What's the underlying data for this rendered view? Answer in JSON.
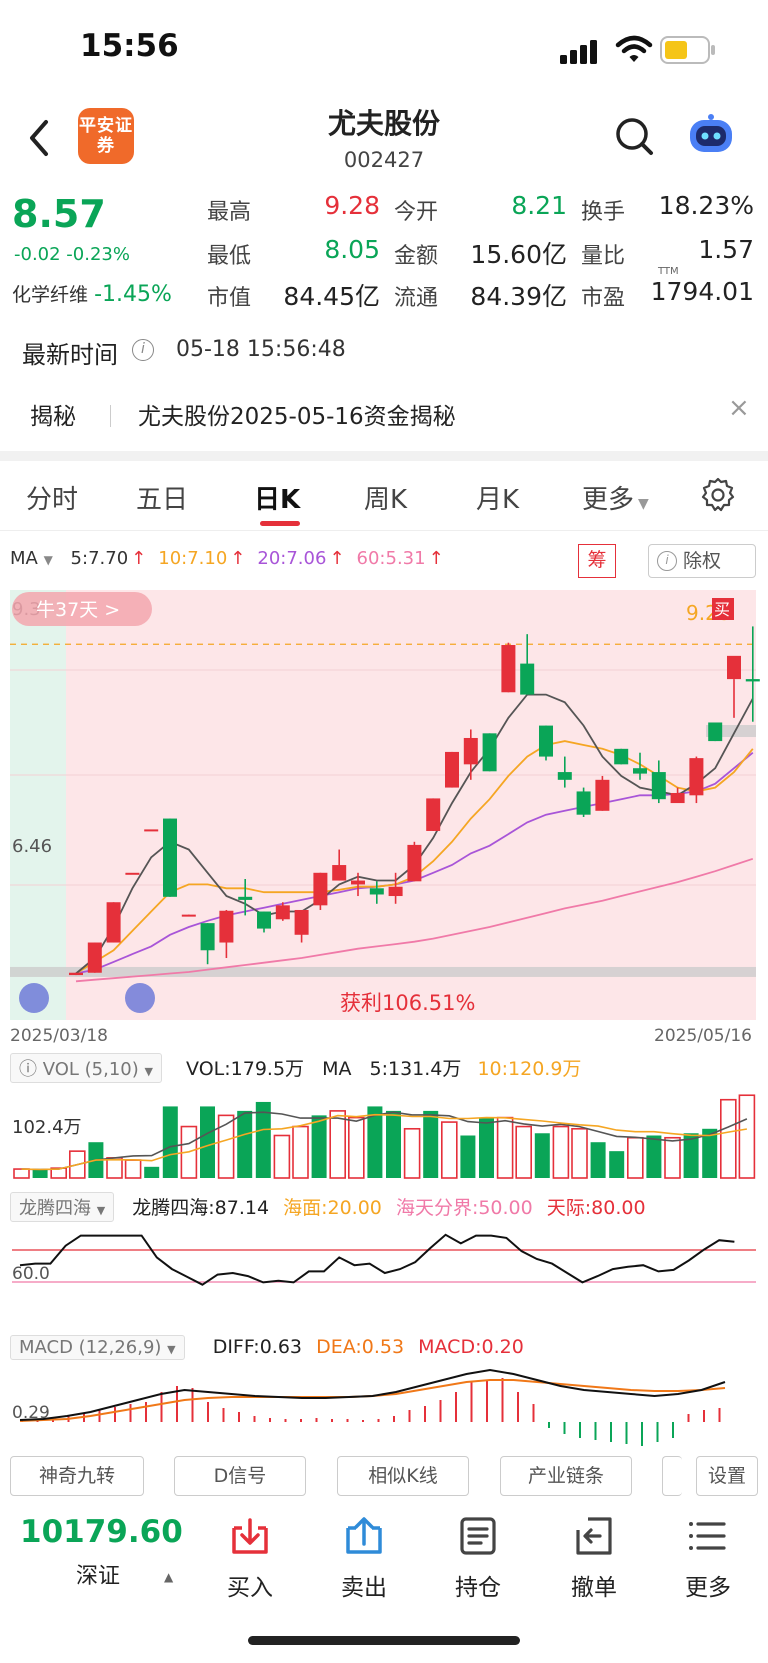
{
  "status": {
    "time": "15:56"
  },
  "header": {
    "logo_text": "平安证券",
    "stock_name": "尤夫股份",
    "stock_code": "002427"
  },
  "quote": {
    "price": "8.57",
    "change": "-0.02 -0.23%",
    "industry_label": "化学纤维",
    "industry_change": "-1.45%",
    "rows": [
      [
        {
          "k": "最高",
          "v": "9.28",
          "c": "red"
        },
        {
          "k": "今开",
          "v": "8.21",
          "c": "green"
        },
        {
          "k": "换手",
          "v": "18.23%",
          "c": "dark"
        }
      ],
      [
        {
          "k": "最低",
          "v": "8.05",
          "c": "green"
        },
        {
          "k": "金额",
          "v": "15.60亿",
          "c": "dark"
        },
        {
          "k": "量比",
          "v": "1.57",
          "c": "dark"
        }
      ],
      [
        {
          "k": "市值",
          "v": "84.45亿",
          "c": "dark"
        },
        {
          "k": "流通",
          "v": "84.39亿",
          "c": "dark"
        },
        {
          "k": "市盈",
          "v": "1794.01",
          "c": "dark"
        }
      ]
    ],
    "ttm": "TTM"
  },
  "latest_time": {
    "label": "最新时间",
    "value": "05-18 15:56:48"
  },
  "reveal": {
    "label": "揭秘",
    "text": "尤夫股份2025-05-16资金揭秘",
    "close": "×"
  },
  "tabs": [
    "分时",
    "五日",
    "日K",
    "周K",
    "月K",
    "更多"
  ],
  "active_tab": "日K",
  "ma": {
    "name": "MA",
    "items": [
      {
        "t": "5:7.70",
        "color": "#333333"
      },
      {
        "t": "10:7.10",
        "color": "#f5a623"
      },
      {
        "t": "20:7.06",
        "color": "#a855d8"
      },
      {
        "t": "60:5.31",
        "color": "#f07aa8"
      }
    ]
  },
  "chou": "筹",
  "fuquan": "除权",
  "chart_data": {
    "type": "candlestick",
    "date_start": "2025/03/18",
    "date_end": "2025/05/16",
    "price_labels": [
      "9.3",
      "6.46"
    ],
    "high_marker": "9.28",
    "buy_marker": "买",
    "streak": "牛37天",
    "profit": "获利106.51%",
    "ohlc": [
      [
        4.78,
        4.81,
        4.78,
        4.81
      ],
      [
        4.81,
        5.2,
        4.81,
        5.2
      ],
      [
        5.2,
        5.72,
        5.2,
        5.72
      ],
      [
        6.1,
        6.1,
        6.1,
        6.1
      ],
      [
        6.66,
        6.66,
        6.66,
        6.66
      ],
      [
        6.8,
        6.8,
        5.79,
        5.79
      ],
      [
        5.55,
        5.56,
        5.55,
        5.56
      ],
      [
        5.45,
        5.45,
        4.92,
        5.1
      ],
      [
        5.2,
        5.62,
        5.0,
        5.61
      ],
      [
        5.79,
        6.02,
        5.55,
        5.75
      ],
      [
        5.6,
        5.6,
        5.33,
        5.38
      ],
      [
        5.5,
        5.72,
        5.48,
        5.68
      ],
      [
        5.3,
        5.62,
        5.2,
        5.62
      ],
      [
        5.68,
        6.1,
        5.62,
        6.1
      ],
      [
        6.0,
        6.4,
        6.0,
        6.2
      ],
      [
        5.95,
        6.1,
        5.8,
        6.0
      ],
      [
        5.9,
        5.99,
        5.7,
        5.82
      ],
      [
        5.8,
        6.1,
        5.7,
        5.92
      ],
      [
        5.99,
        6.5,
        5.99,
        6.46
      ],
      [
        6.64,
        7.06,
        6.64,
        7.06
      ],
      [
        7.2,
        7.66,
        7.2,
        7.66
      ],
      [
        7.5,
        7.95,
        7.3,
        7.84
      ],
      [
        7.9,
        7.9,
        7.41,
        7.41
      ],
      [
        8.43,
        9.07,
        8.43,
        9.04
      ],
      [
        8.8,
        9.18,
        8.4,
        8.4
      ],
      [
        8.0,
        8.0,
        7.55,
        7.6
      ],
      [
        7.4,
        7.6,
        7.2,
        7.3
      ],
      [
        7.15,
        7.2,
        6.82,
        6.85
      ],
      [
        6.9,
        7.35,
        6.9,
        7.3
      ],
      [
        7.7,
        7.7,
        7.5,
        7.5
      ],
      [
        7.45,
        7.65,
        7.3,
        7.38
      ],
      [
        7.4,
        7.55,
        7.0,
        7.05
      ],
      [
        7.0,
        7.2,
        7.05,
        7.13
      ],
      [
        7.1,
        7.6,
        7.0,
        7.58
      ],
      [
        8.04,
        8.04,
        7.8,
        7.8
      ],
      [
        8.6,
        8.6,
        8.1,
        8.9
      ],
      [
        8.6,
        9.28,
        8.05,
        8.57
      ]
    ],
    "ma5": [
      4.8,
      5.0,
      5.4,
      5.9,
      6.3,
      6.5,
      6.4,
      6.1,
      5.8,
      5.7,
      5.55,
      5.6,
      5.6,
      5.75,
      5.95,
      6.05,
      6.0,
      6.0,
      6.2,
      6.55,
      7.0,
      7.4,
      7.7,
      8.1,
      8.4,
      8.4,
      8.3,
      8.0,
      7.6,
      7.35,
      7.2,
      7.15,
      7.1,
      7.25,
      7.45,
      7.9,
      8.35
    ],
    "ma10": [
      4.8,
      4.95,
      5.1,
      5.35,
      5.6,
      5.85,
      5.95,
      5.95,
      5.9,
      5.9,
      5.85,
      5.85,
      5.85,
      5.85,
      5.88,
      5.92,
      5.92,
      5.95,
      6.05,
      6.25,
      6.5,
      6.8,
      7.05,
      7.35,
      7.6,
      7.75,
      7.8,
      7.75,
      7.7,
      7.62,
      7.5,
      7.35,
      7.2,
      7.15,
      7.2,
      7.4,
      7.7
    ],
    "ma20": [
      4.8,
      4.85,
      4.95,
      5.05,
      5.15,
      5.3,
      5.4,
      5.48,
      5.55,
      5.6,
      5.65,
      5.7,
      5.75,
      5.8,
      5.85,
      5.9,
      5.92,
      5.95,
      6.0,
      6.1,
      6.2,
      6.35,
      6.45,
      6.6,
      6.75,
      6.85,
      6.9,
      6.95,
      7.0,
      7.05,
      7.1,
      7.1,
      7.12,
      7.15,
      7.25,
      7.45,
      7.65
    ],
    "ma60": [
      4.7,
      4.72,
      4.74,
      4.76,
      4.78,
      4.8,
      4.82,
      4.85,
      4.88,
      4.91,
      4.94,
      4.97,
      5.0,
      5.04,
      5.08,
      5.12,
      5.15,
      5.18,
      5.21,
      5.25,
      5.3,
      5.35,
      5.4,
      5.46,
      5.52,
      5.58,
      5.64,
      5.69,
      5.74,
      5.8,
      5.86,
      5.92,
      5.98,
      6.05,
      6.12,
      6.2,
      6.28
    ]
  },
  "vol": {
    "selector": "VOL (5,10)",
    "vol": "VOL:179.5万",
    "ma": "MA",
    "ma5": "5:131.4万",
    "ma10": "10:120.9万",
    "axis": "102.4万",
    "values": [
      20,
      18,
      22,
      60,
      80,
      45,
      40,
      25,
      160,
      115,
      160,
      140,
      150,
      170,
      95,
      115,
      140,
      150,
      135,
      160,
      150,
      110,
      150,
      125,
      95,
      135,
      135,
      115,
      100,
      115,
      110,
      80,
      60,
      90,
      95,
      90,
      100,
      110,
      175,
      185
    ]
  },
  "dragon": {
    "selector": "龙腾四海",
    "value": "龙腾四海:87.14",
    "hai": "海面:20.00",
    "haitian": "海天分界:50.00",
    "tianji": "天际:80.00",
    "axis": "60.0"
  },
  "macd": {
    "selector": "MACD (12,26,9)",
    "diff": "DIFF:0.63",
    "dea": "DEA:0.53",
    "macd": "MACD:0.20",
    "axis": "0.29"
  },
  "chips": [
    "神奇九转",
    "D信号",
    "相似K线",
    "产业链条",
    "设置"
  ],
  "bottom": {
    "index_value": "10179.60",
    "index_name": "深证",
    "buttons": [
      {
        "label": "买入",
        "icon": "buy-icon"
      },
      {
        "label": "卖出",
        "icon": "sell-icon"
      },
      {
        "label": "持仓",
        "icon": "position-icon"
      },
      {
        "label": "撤单",
        "icon": "cancel-order-icon"
      },
      {
        "label": "更多",
        "icon": "more-icon"
      }
    ]
  }
}
